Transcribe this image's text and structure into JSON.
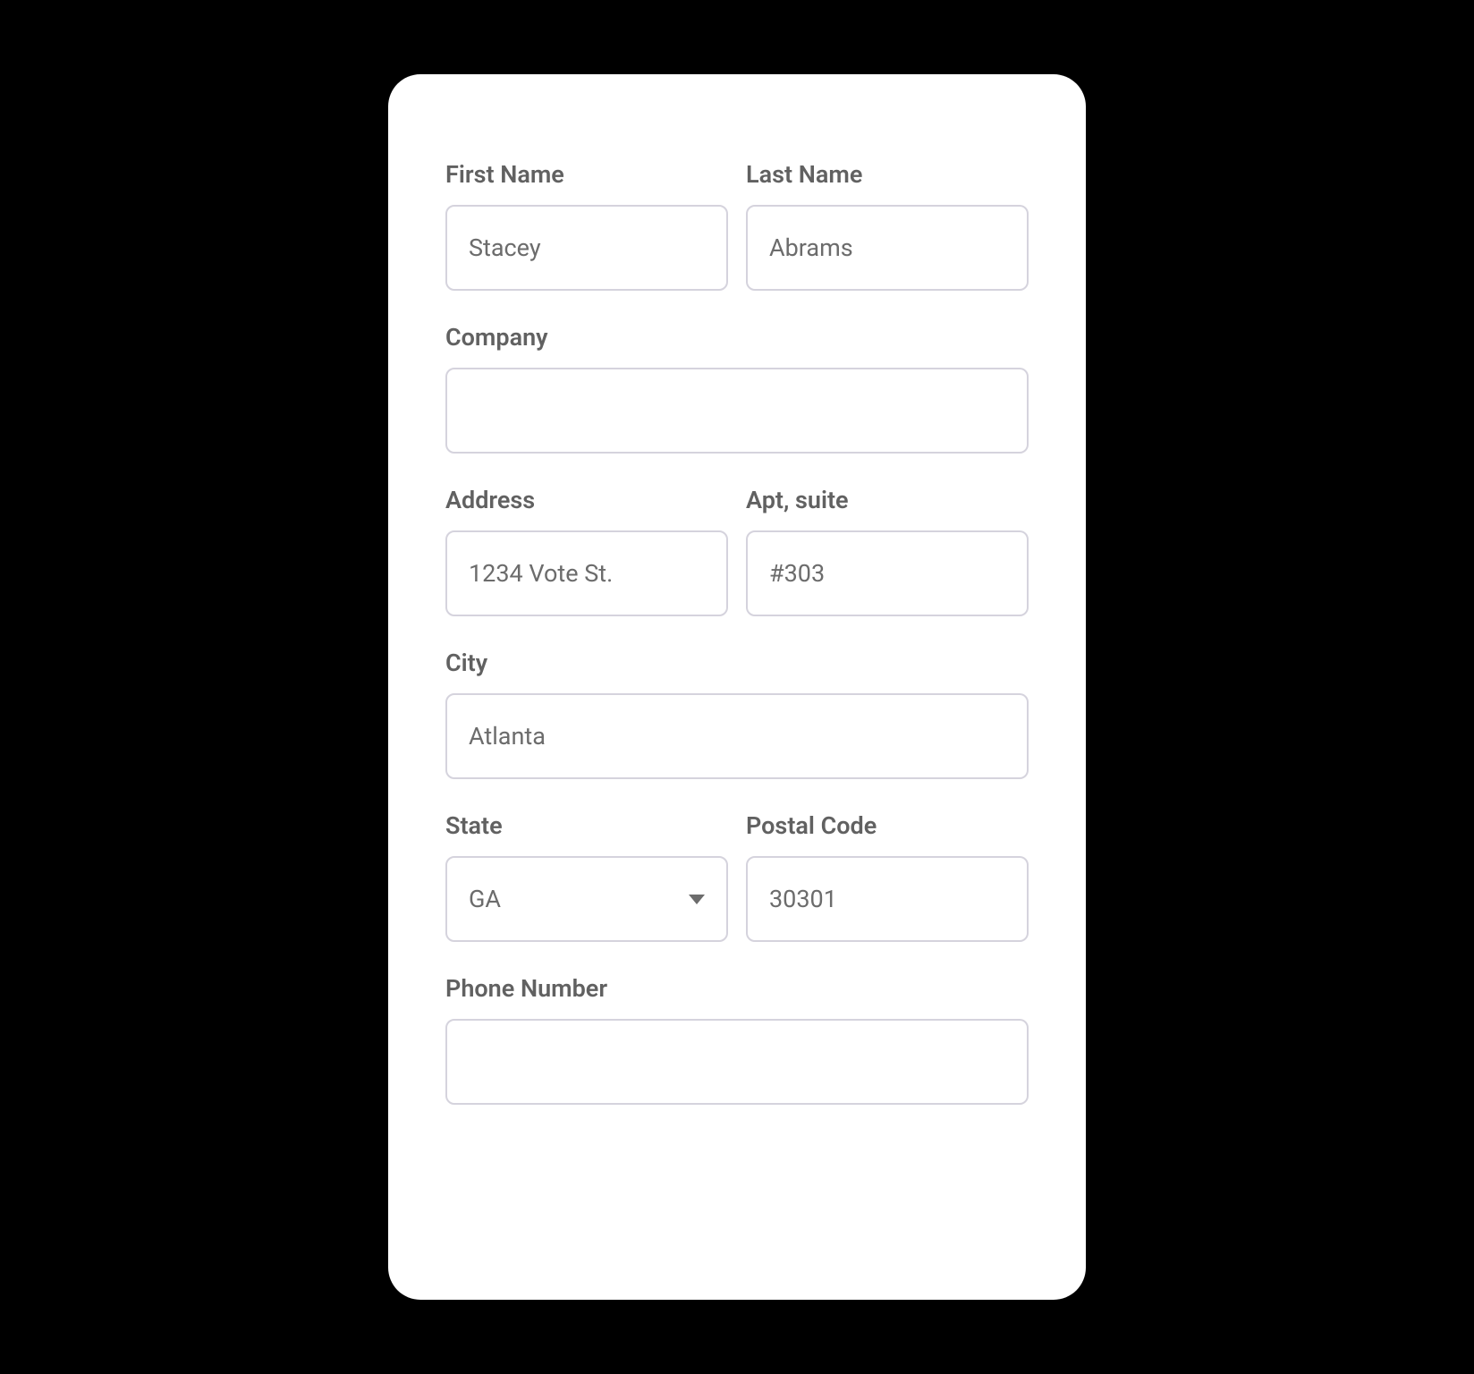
{
  "form": {
    "first_name": {
      "label": "First Name",
      "value": "Stacey"
    },
    "last_name": {
      "label": "Last Name",
      "value": "Abrams"
    },
    "company": {
      "label": "Company",
      "value": ""
    },
    "address": {
      "label": "Address",
      "value": "1234 Vote St."
    },
    "apt": {
      "label": "Apt, suite",
      "value": "#303"
    },
    "city": {
      "label": "City",
      "value": "Atlanta"
    },
    "state": {
      "label": "State",
      "value": "GA"
    },
    "postal": {
      "label": "Postal Code",
      "value": "30301"
    },
    "phone": {
      "label": "Phone Number",
      "value": ""
    }
  }
}
